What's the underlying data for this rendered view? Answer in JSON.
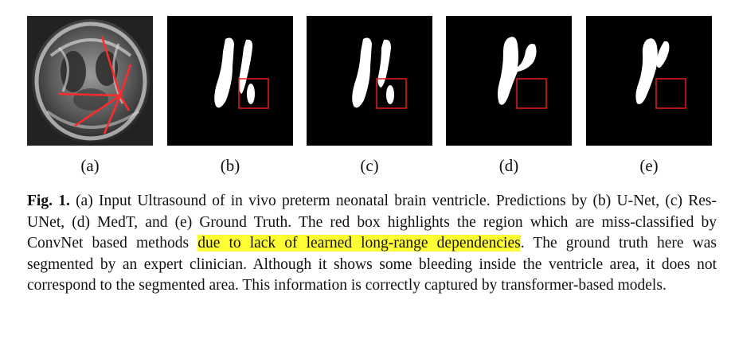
{
  "figure": {
    "colors": {
      "background": "#ffffff",
      "mask_background": "#000000",
      "mask_foreground": "#ffffff",
      "highlight_box": "#e81b1b",
      "ultrasound_lines": "#ff2a2a",
      "text_highlight": "#ffff33"
    },
    "panels": [
      {
        "label": "(a)",
        "content": "ultrasound-image"
      },
      {
        "label": "(b)",
        "content": "unet-mask"
      },
      {
        "label": "(c)",
        "content": "resunet-mask"
      },
      {
        "label": "(d)",
        "content": "medt-mask"
      },
      {
        "label": "(e)",
        "content": "ground-truth-mask"
      }
    ]
  },
  "caption": {
    "label": "Fig. 1.",
    "part1": " (a) Input Ultrasound of in vivo preterm neonatal brain ventricle. Predictions by (b) U-Net, (c) Res-UNet, (d) MedT, and (e) Ground Truth. The red box highlights the region which are miss-classified by ConvNet based methods ",
    "highlighted": "due to lack of learned long-range dependencies",
    "part2": ". The ground truth here was segmented by an expert clinician. Although it shows some bleeding inside the ventricle area, it does not correspond to the segmented area. This information is correctly captured by transformer-based models."
  }
}
